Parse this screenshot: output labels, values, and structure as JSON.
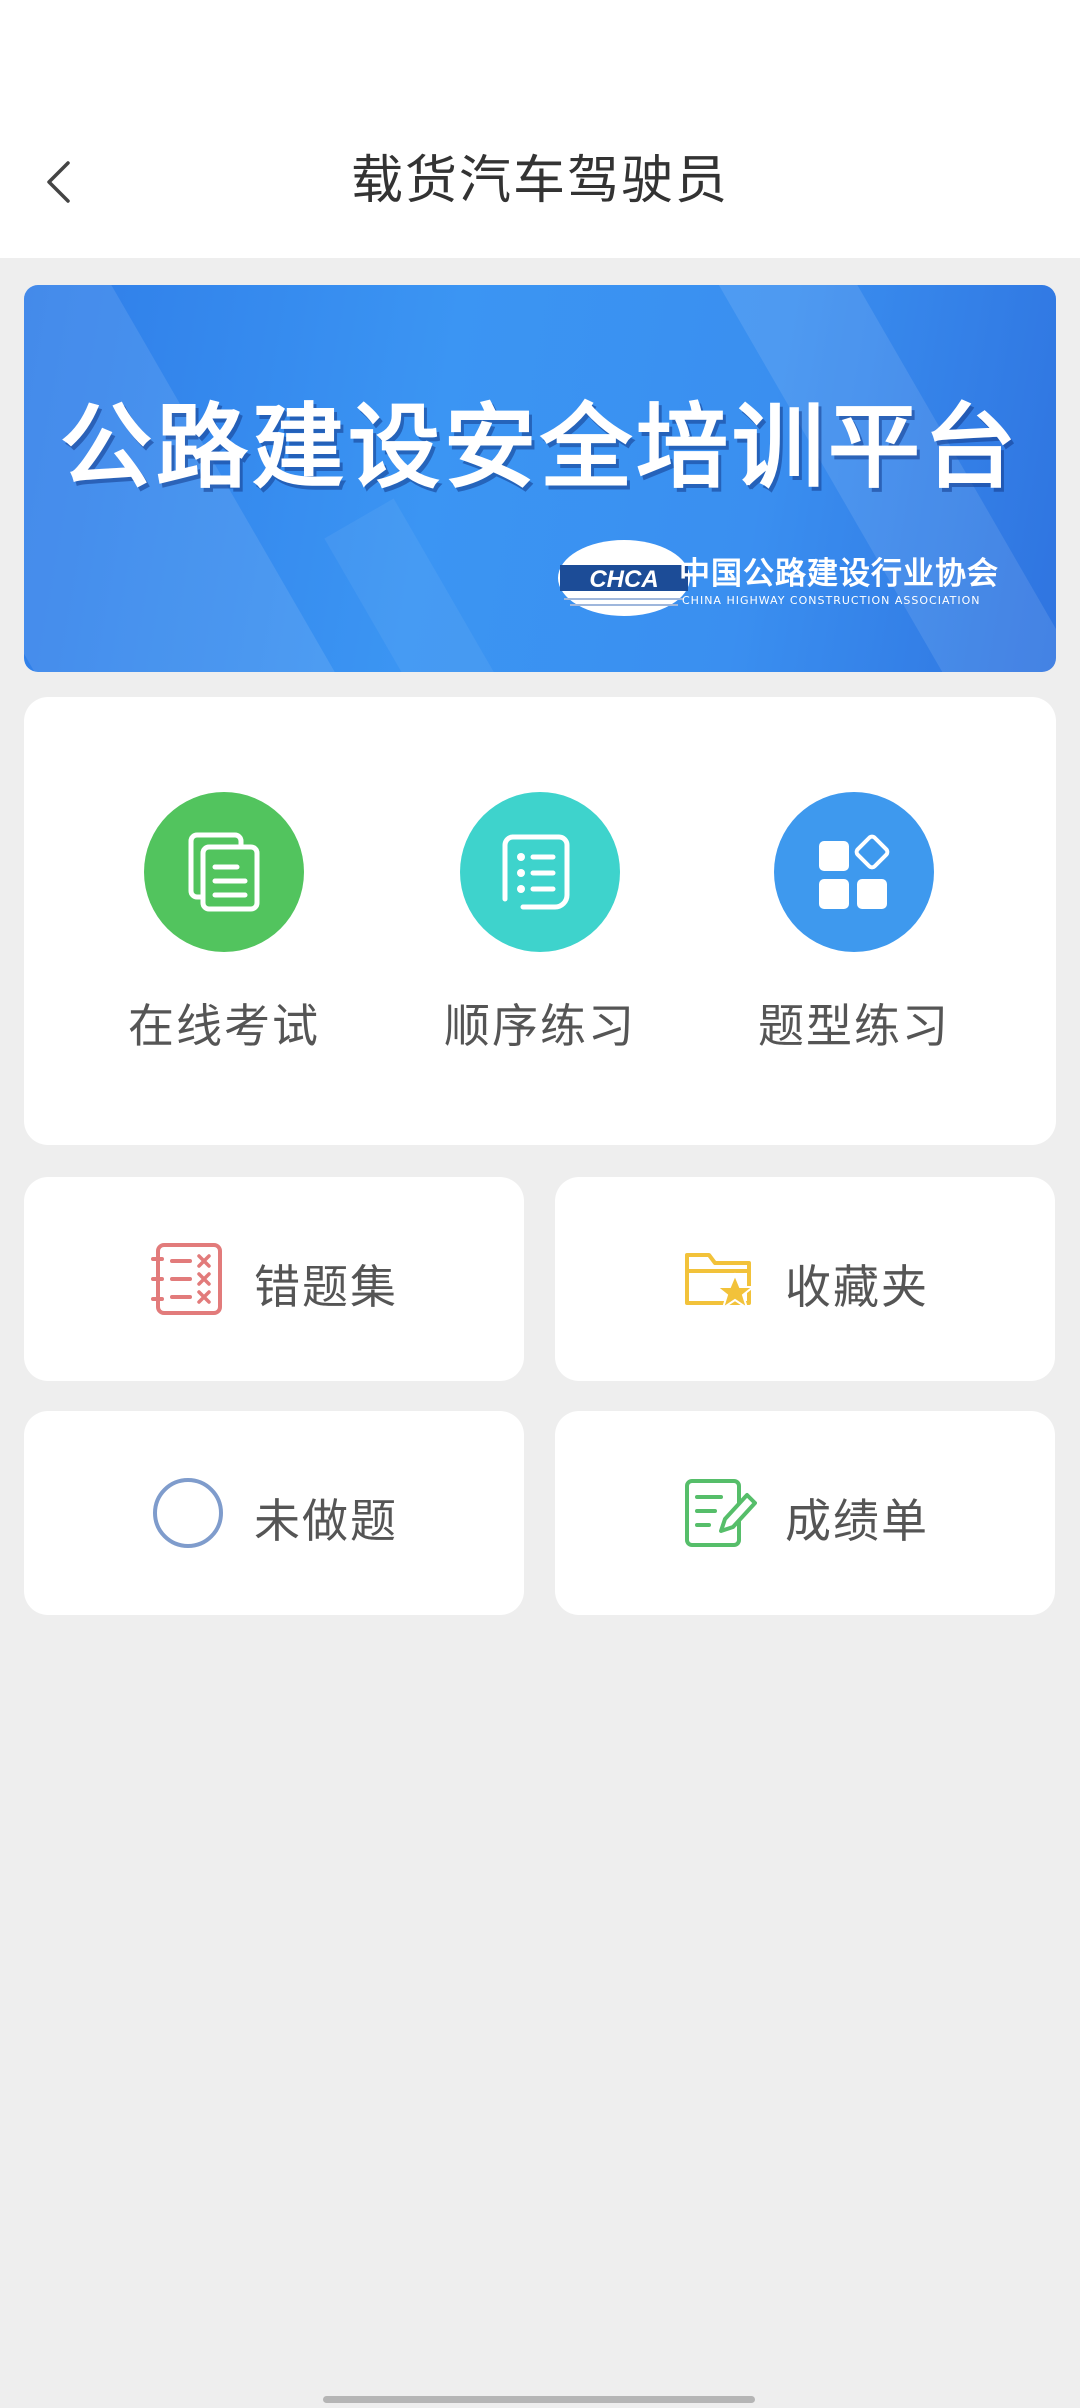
{
  "header": {
    "title": "载货汽车驾驶员"
  },
  "banner": {
    "title": "公路建设安全培训平台",
    "logo_text": "CHCA",
    "org_cn": "中国公路建设行业协会",
    "org_en": "CHINA HIGHWAY CONSTRUCTION ASSOCIATION"
  },
  "features": [
    {
      "label": "在线考试",
      "icon": "exam-paper-icon",
      "color": "#52c45e"
    },
    {
      "label": "顺序练习",
      "icon": "list-practice-icon",
      "color": "#3ed3cc"
    },
    {
      "label": "题型练习",
      "icon": "question-type-grid-icon",
      "color": "#3e99ee"
    }
  ],
  "tiles": [
    {
      "label": "错题集",
      "icon": "wrong-questions-icon",
      "color": "#e27b7b"
    },
    {
      "label": "收藏夹",
      "icon": "favorites-folder-icon",
      "color": "#f2c23a"
    },
    {
      "label": "未做题",
      "icon": "undone-circle-icon",
      "color": "#7f9ccc"
    },
    {
      "label": "成绩单",
      "icon": "score-report-icon",
      "color": "#56be6a"
    }
  ]
}
